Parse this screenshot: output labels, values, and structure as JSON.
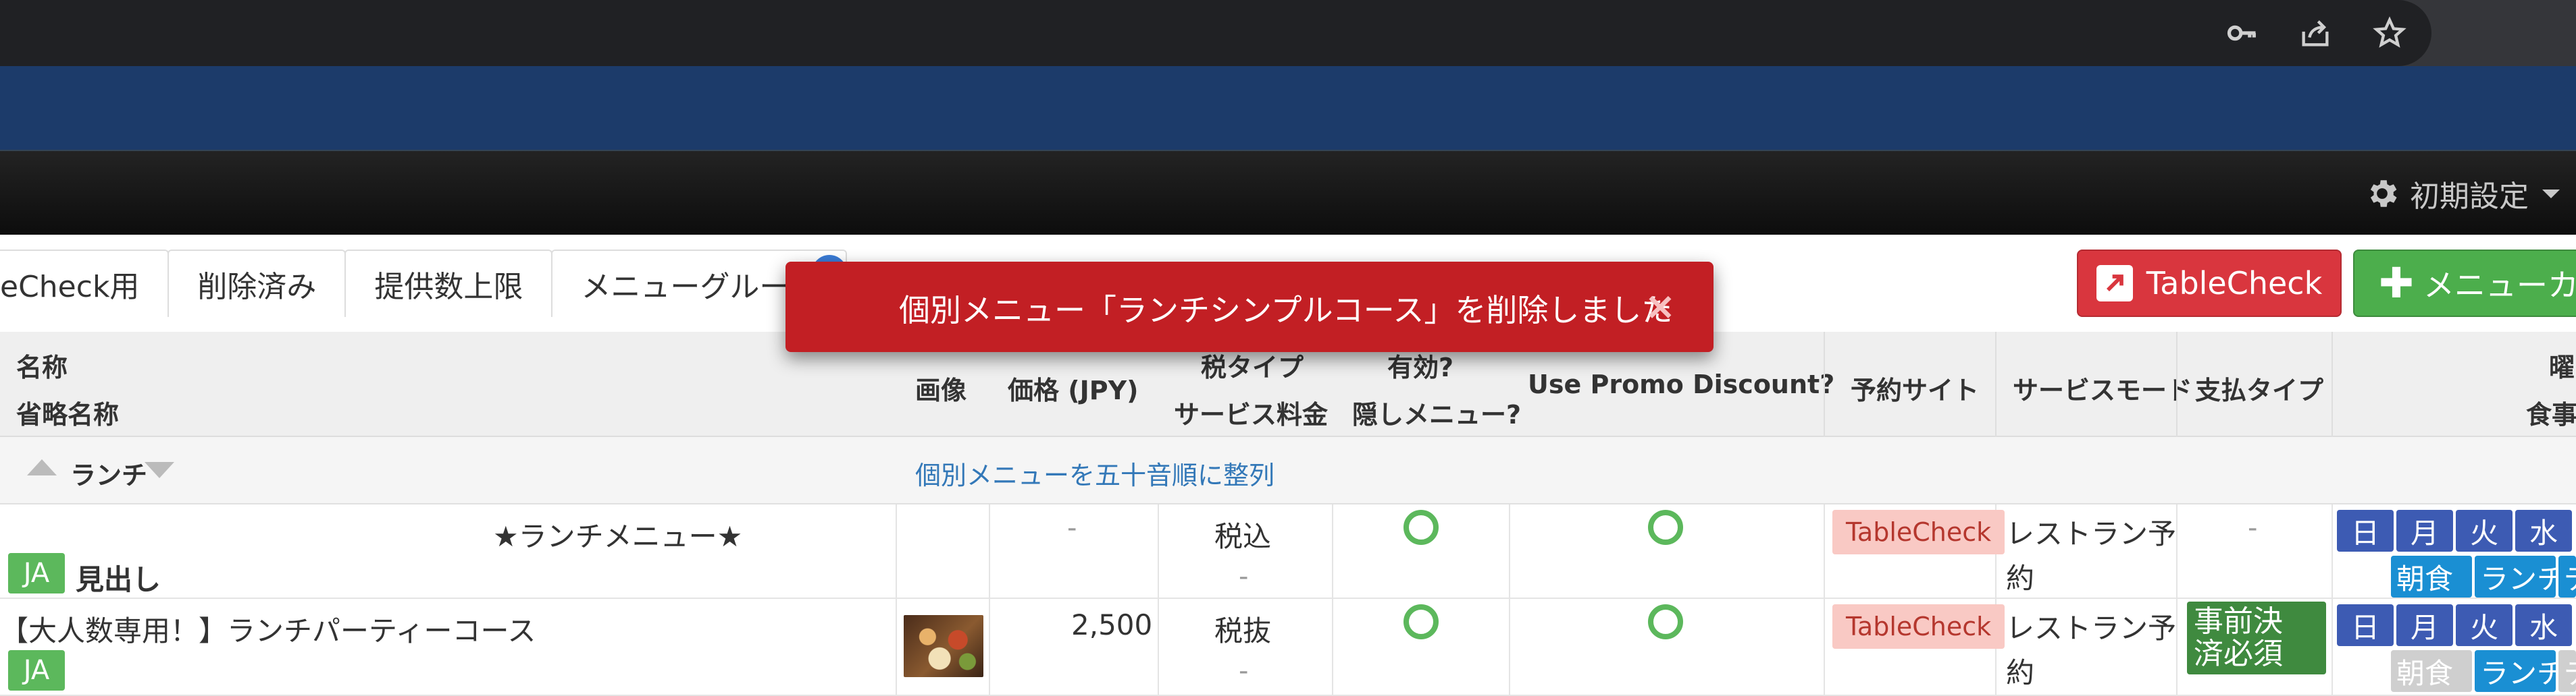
{
  "browser": {
    "icons": [
      "key-icon",
      "share-icon",
      "star-icon"
    ]
  },
  "header": {
    "settings_label": "初期設定"
  },
  "tabs": [
    {
      "label": "eCheck用"
    },
    {
      "label": "削除済み"
    },
    {
      "label": "提供数上限"
    },
    {
      "label": "メニューグループ"
    }
  ],
  "buttons": {
    "tablecheck": "TableCheck",
    "menu_category": "メニューカテゴリ"
  },
  "toast": {
    "message": "個別メニュー「ランチシンプルコース」を削除しました",
    "close": "×"
  },
  "table_header": {
    "name": "名称",
    "short_name": "省略名称",
    "image": "画像",
    "price": "価格 (JPY)",
    "tax_type": "税タイプ",
    "service_charge": "サービス料金",
    "valid": "有効?",
    "hidden_menu": "隠しメニュー?",
    "use_promo": "Use Promo Discount?",
    "reservation_site": "予約サイト",
    "service_mode": "サービスモード",
    "payment_type": "支払タイプ",
    "weekday": "曜",
    "meal": "食事"
  },
  "group": {
    "name": "ランチ",
    "sort_link": "個別メニューを五十音順に整列"
  },
  "rows": [
    {
      "title": "★ランチメニュー★",
      "lang": "JA",
      "subtitle": "見出し",
      "price": "-",
      "tax": "税込",
      "service_charge": "-",
      "site": "TableCheck",
      "mode_line1": "レストラン予",
      "mode_line2": "約",
      "payment": "-",
      "days": [
        "日",
        "月",
        "火",
        "水"
      ],
      "meals": [
        "朝食",
        "ランチ",
        "ディナー"
      ]
    },
    {
      "title": "【大人数専用！】ランチパーティーコース",
      "lang": "JA",
      "price": "2,500",
      "tax": "税抜",
      "service_charge": "-",
      "site": "TableCheck",
      "mode_line1": "レストラン予",
      "mode_line2": "約",
      "payment_line1": "事前決",
      "payment_line2": "済必須",
      "days": [
        "日",
        "月",
        "火",
        "水"
      ],
      "meals": [
        "朝食",
        "ランチ",
        "ディナー"
      ]
    }
  ],
  "colors": {
    "toast_bg": "#c21f24",
    "tablecheck_btn": "#d9363e",
    "add_btn": "#4cae4c",
    "ja_badge": "#5cb85c",
    "day_badge": "#3d5bb3",
    "meal_active": "#1a8fd3"
  }
}
